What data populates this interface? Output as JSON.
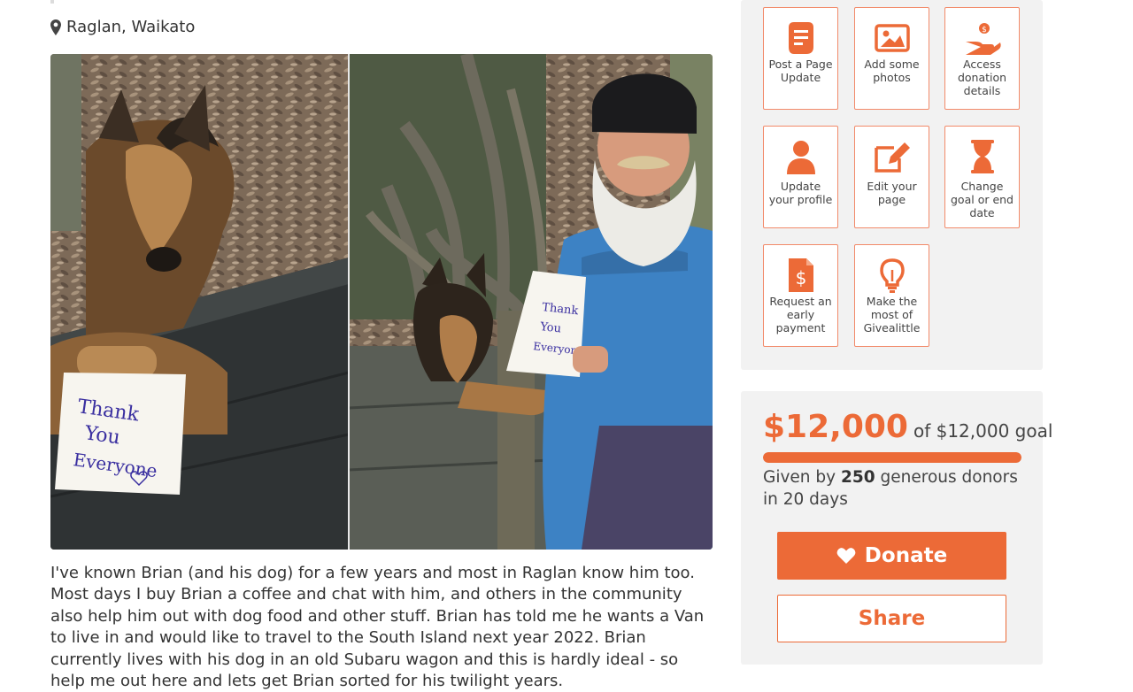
{
  "location": {
    "icon": "map-marker-icon",
    "text": "Raglan, Waikato"
  },
  "photo": {
    "left_card_text": [
      "Thank",
      "You",
      "Everyone"
    ],
    "right_card_text": [
      "Thank",
      "You",
      "Everyone"
    ]
  },
  "story": "I've known Brian (and his dog) for a few years and most in Raglan know him too. Most days I buy Brian a coffee and chat with him, and others in the community also help him out with dog food and other stuff. Brian has told me he wants a Van to live in and would like to travel to the South Island next year 2022. Brian currently lives with his dog in an old Subaru wagon and this is hardly ideal - so help me out here and lets get Brian sorted for his twilight years.",
  "tools": [
    {
      "icon": "page-update-icon",
      "label": "Post a Page Update"
    },
    {
      "icon": "photos-icon",
      "label": "Add some photos"
    },
    {
      "icon": "hand-money-icon",
      "label": "Access donation details"
    },
    {
      "icon": "user-icon",
      "label": "Update your profile"
    },
    {
      "icon": "pencil-icon",
      "label": "Edit your page"
    },
    {
      "icon": "hourglass-icon",
      "label": "Change goal or end date"
    },
    {
      "icon": "dollar-document-icon",
      "label": "Request an early payment"
    },
    {
      "icon": "lightbulb-icon",
      "label": "Make the most of Givealittle"
    }
  ],
  "progress": {
    "raised": "$12,000",
    "goal_text": "of $12,000 goal",
    "fraction": 1.0,
    "given_by": "Given by",
    "donor_count": "250",
    "donors_suffix": "generous donors in 20 days"
  },
  "buttons": {
    "donate": "Donate",
    "share": "Share"
  },
  "colors": {
    "accent": "#ec6a37",
    "tile_border": "#f28a6a",
    "panel_bg": "#f2f2f2",
    "bar_track": "#e3e3e3"
  }
}
